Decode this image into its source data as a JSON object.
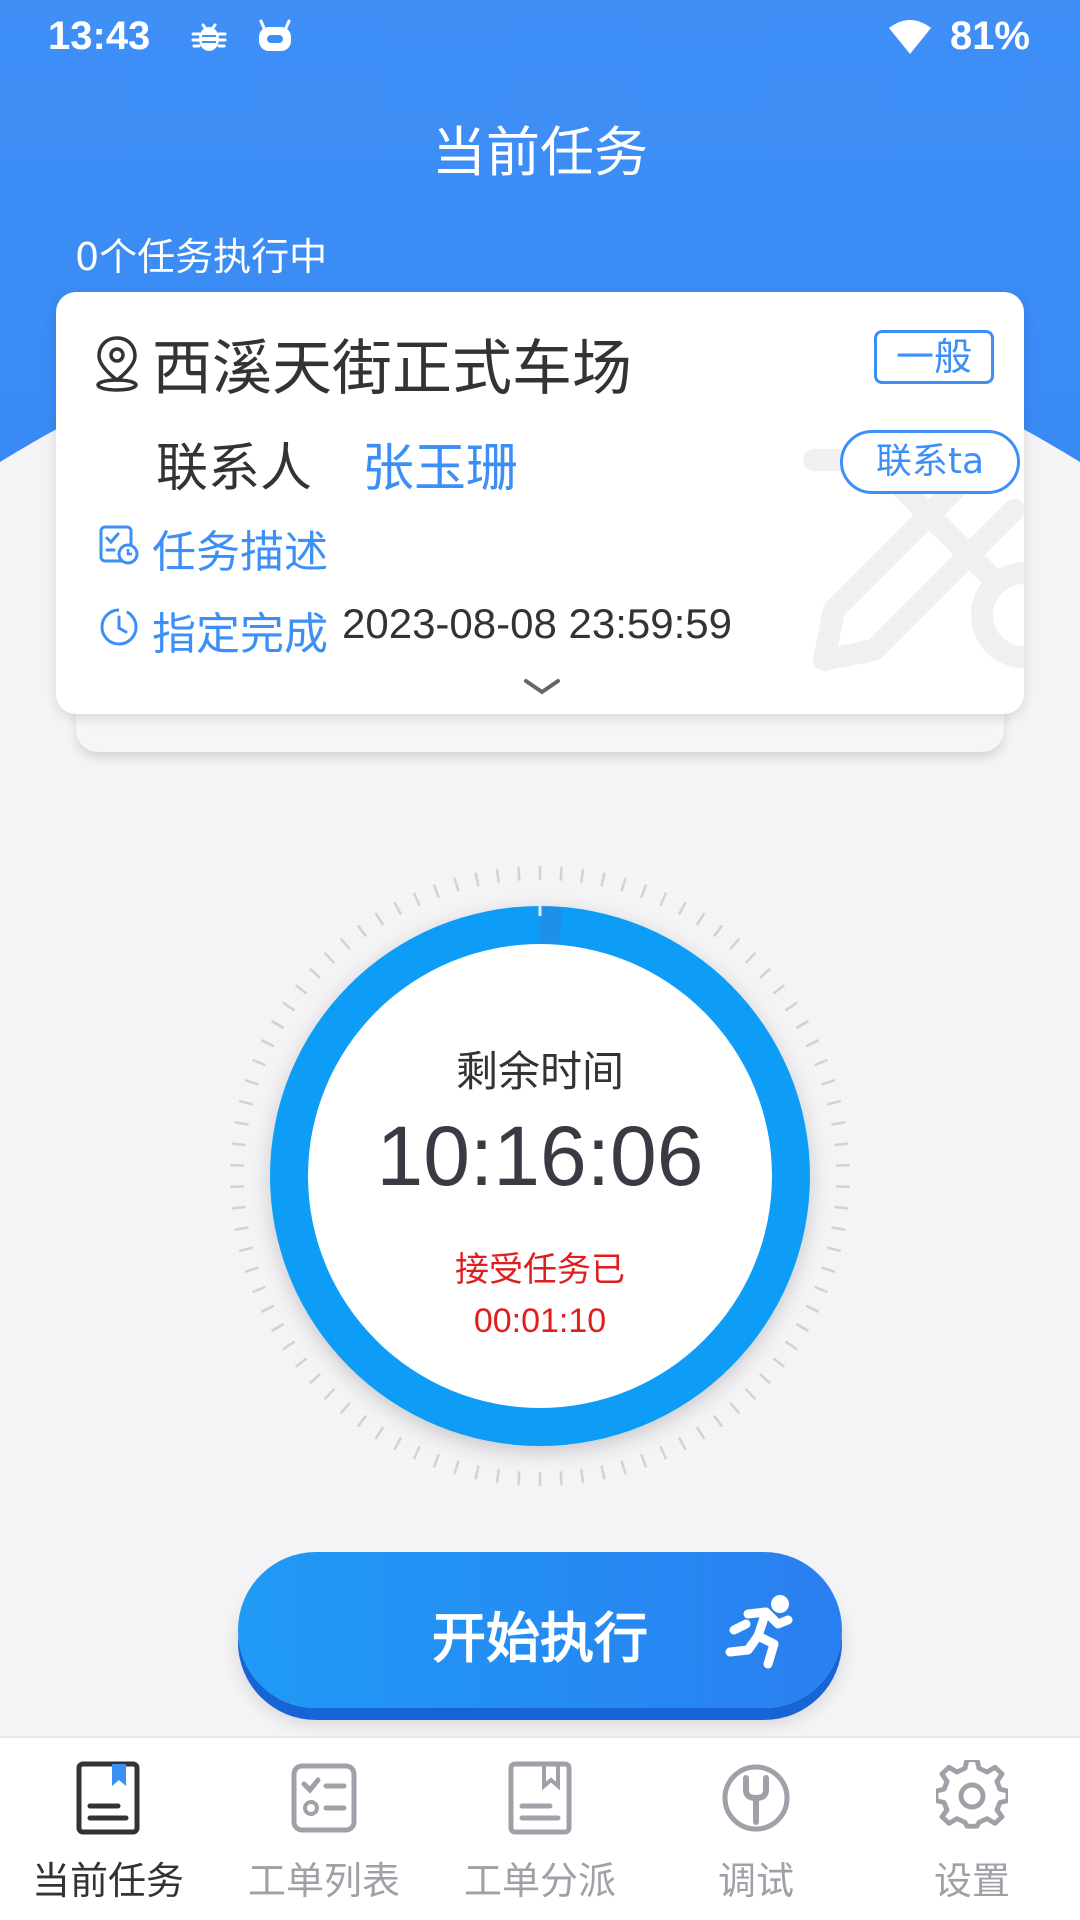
{
  "status_bar": {
    "time": "13:43",
    "battery": "81%"
  },
  "header": {
    "title": "当前任务",
    "running_count": "0个任务执行中"
  },
  "task_card": {
    "site_name": "西溪天街正式车场",
    "priority": "一般",
    "contact_label": "联系人",
    "contact_name": "张玉珊",
    "contact_button": "联系ta",
    "description_label": "任务描述",
    "due_label": "指定完成",
    "due_value": "2023-08-08 23:59:59"
  },
  "timer": {
    "label": "剩余时间",
    "remaining": "10:16:06",
    "accepted_label": "接受任务已",
    "accepted_elapsed": "00:01:10"
  },
  "start_button": {
    "label": "开始执行"
  },
  "bottom_nav": {
    "items": [
      {
        "label": "当前任务",
        "icon": "current-task-icon",
        "active": true
      },
      {
        "label": "工单列表",
        "icon": "work-order-list-icon",
        "active": false
      },
      {
        "label": "工单分派",
        "icon": "work-order-dispatch-icon",
        "active": false
      },
      {
        "label": "调试",
        "icon": "debug-wrench-icon",
        "active": false
      },
      {
        "label": "设置",
        "icon": "settings-gear-icon",
        "active": false
      }
    ]
  },
  "colors": {
    "primary": "#3b8ff7",
    "timer_ring": "#0a9cf6",
    "alert": "#e01e1e",
    "text": "#333333"
  }
}
